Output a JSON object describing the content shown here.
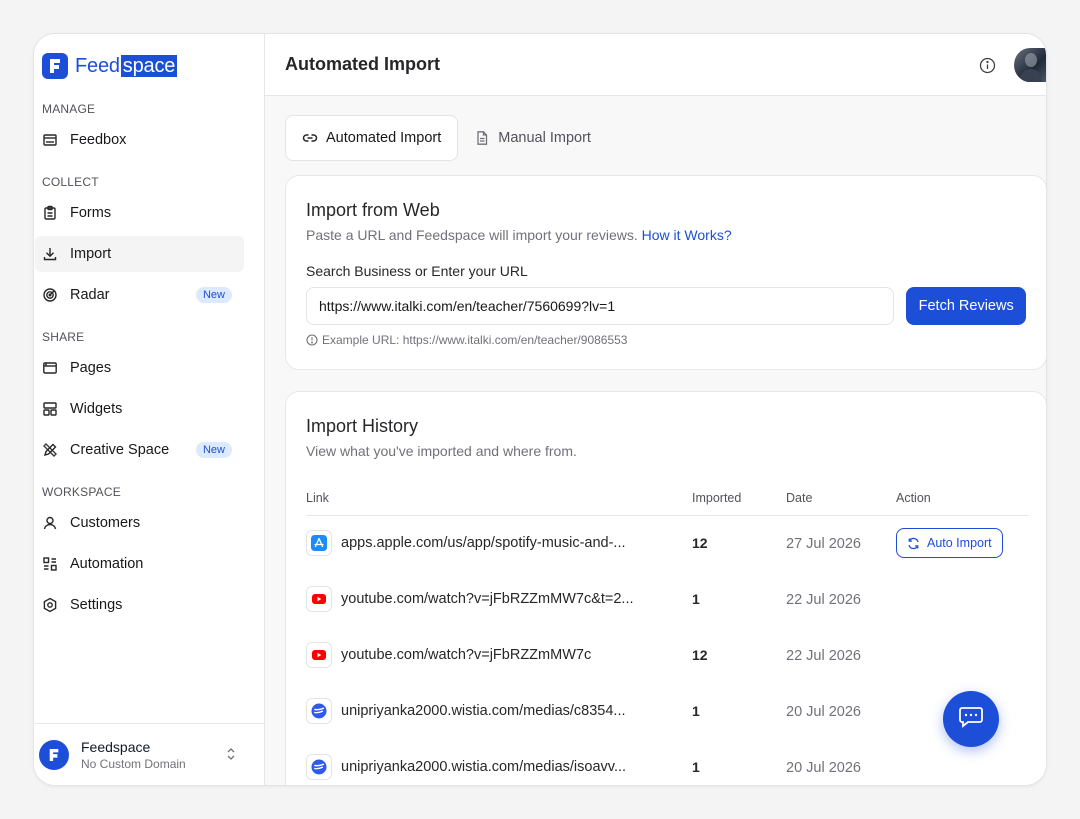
{
  "brand": {
    "name_part1": "Feed",
    "name_part2": "space"
  },
  "sidebar": {
    "sections": [
      {
        "label": "MANAGE"
      },
      {
        "label": "COLLECT"
      },
      {
        "label": "SHARE"
      },
      {
        "label": "WORKSPACE"
      }
    ],
    "items": [
      {
        "label": "Feedbox",
        "icon": "inbox-icon"
      },
      {
        "label": "Forms",
        "icon": "clipboard-icon"
      },
      {
        "label": "Import",
        "icon": "download-icon",
        "active": true
      },
      {
        "label": "Radar",
        "icon": "radar-icon",
        "badge": "New"
      },
      {
        "label": "Pages",
        "icon": "browser-icon"
      },
      {
        "label": "Widgets",
        "icon": "layout-icon"
      },
      {
        "label": "Creative Space",
        "icon": "pencil-ruler-icon",
        "badge": "New"
      },
      {
        "label": "Customers",
        "icon": "user-icon"
      },
      {
        "label": "Automation",
        "icon": "automation-icon"
      },
      {
        "label": "Settings",
        "icon": "settings-hex-icon"
      }
    ],
    "workspace": {
      "name": "Feedspace",
      "domain": "No Custom Domain"
    }
  },
  "header": {
    "title": "Automated Import"
  },
  "tabs": [
    {
      "label": "Automated Import",
      "active": true
    },
    {
      "label": "Manual Import",
      "active": false
    }
  ],
  "import_web": {
    "title": "Import from Web",
    "subtitle": "Paste a URL and Feedspace will import your reviews.",
    "link_label": "How it Works?",
    "field_label": "Search Business or Enter your URL",
    "url_value": "https://www.italki.com/en/teacher/7560699?lv=1",
    "button_label": "Fetch Reviews",
    "hint": "Example URL: https://www.italki.com/en/teacher/9086553"
  },
  "history": {
    "title": "Import History",
    "subtitle": "View what you've imported and where from.",
    "columns": [
      "Link",
      "Imported",
      "Date",
      "Action"
    ],
    "rows": [
      {
        "source": "app-store",
        "link": "apps.apple.com/us/app/spotify-music-and-...",
        "imported": "12",
        "date": "27 Jul 2026",
        "action": "Auto Import"
      },
      {
        "source": "youtube",
        "link": "youtube.com/watch?v=jFbRZZmMW7c&t=2...",
        "imported": "1",
        "date": "22 Jul 2026",
        "action": ""
      },
      {
        "source": "youtube",
        "link": "youtube.com/watch?v=jFbRZZmMW7c",
        "imported": "12",
        "date": "22 Jul 2026",
        "action": ""
      },
      {
        "source": "wistia",
        "link": "unipriyanka2000.wistia.com/medias/c8354...",
        "imported": "1",
        "date": "20 Jul 2026",
        "action": ""
      },
      {
        "source": "wistia",
        "link": "unipriyanka2000.wistia.com/medias/isoavv...",
        "imported": "1",
        "date": "20 Jul 2026",
        "action": ""
      }
    ]
  },
  "colors": {
    "accent": "#1d4ed8",
    "youtube": "#ff0000",
    "app_store": "#1a8cff",
    "wistia": "#2f5bea"
  }
}
